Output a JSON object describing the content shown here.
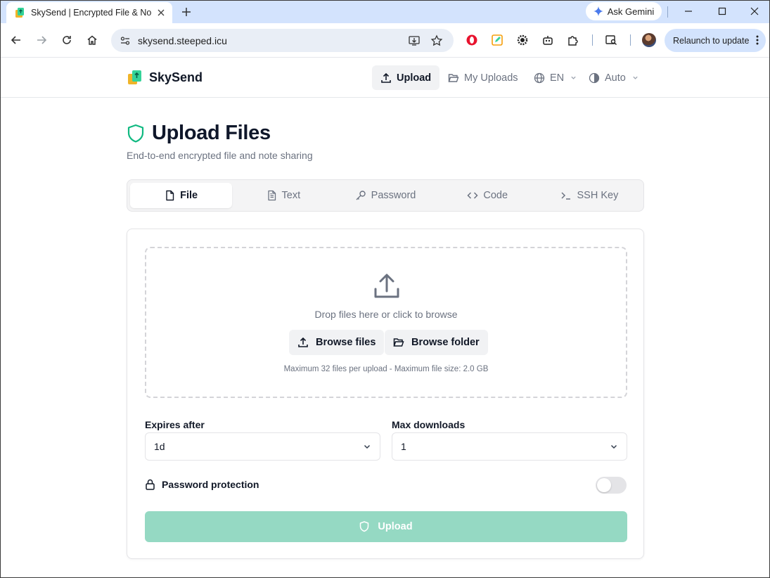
{
  "browser": {
    "tab": {
      "title": "SkySend | Encrypted File & Note Sharing"
    },
    "gemini_label": "Ask Gemini",
    "url": "skysend.steeped.icu",
    "relaunch_label": "Relaunch to update"
  },
  "header": {
    "brand": "SkySend",
    "nav": {
      "upload": "Upload",
      "my_uploads": "My Uploads",
      "language": "EN",
      "theme": "Auto"
    }
  },
  "page": {
    "title": "Upload Files",
    "subtitle": "End-to-end encrypted file and note sharing"
  },
  "tabs": [
    {
      "label": "File",
      "icon": "file-icon",
      "active": true
    },
    {
      "label": "Text",
      "icon": "text-file-icon",
      "active": false
    },
    {
      "label": "Password",
      "icon": "key-icon",
      "active": false
    },
    {
      "label": "Code",
      "icon": "code-icon",
      "active": false
    },
    {
      "label": "SSH Key",
      "icon": "terminal-icon",
      "active": false
    }
  ],
  "dropzone": {
    "text": "Drop files here or click to browse",
    "browse_files": "Browse files",
    "browse_folder": "Browse folder",
    "note": "Maximum 32 files per upload - Maximum file size: 2.0 GB"
  },
  "form": {
    "expires_label": "Expires after",
    "expires_value": "1d",
    "downloads_label": "Max downloads",
    "downloads_value": "1",
    "password_label": "Password protection",
    "password_enabled": false,
    "submit": "Upload"
  },
  "colors": {
    "accent": "#10b981",
    "upload_button_disabled": "#95d9c3"
  }
}
